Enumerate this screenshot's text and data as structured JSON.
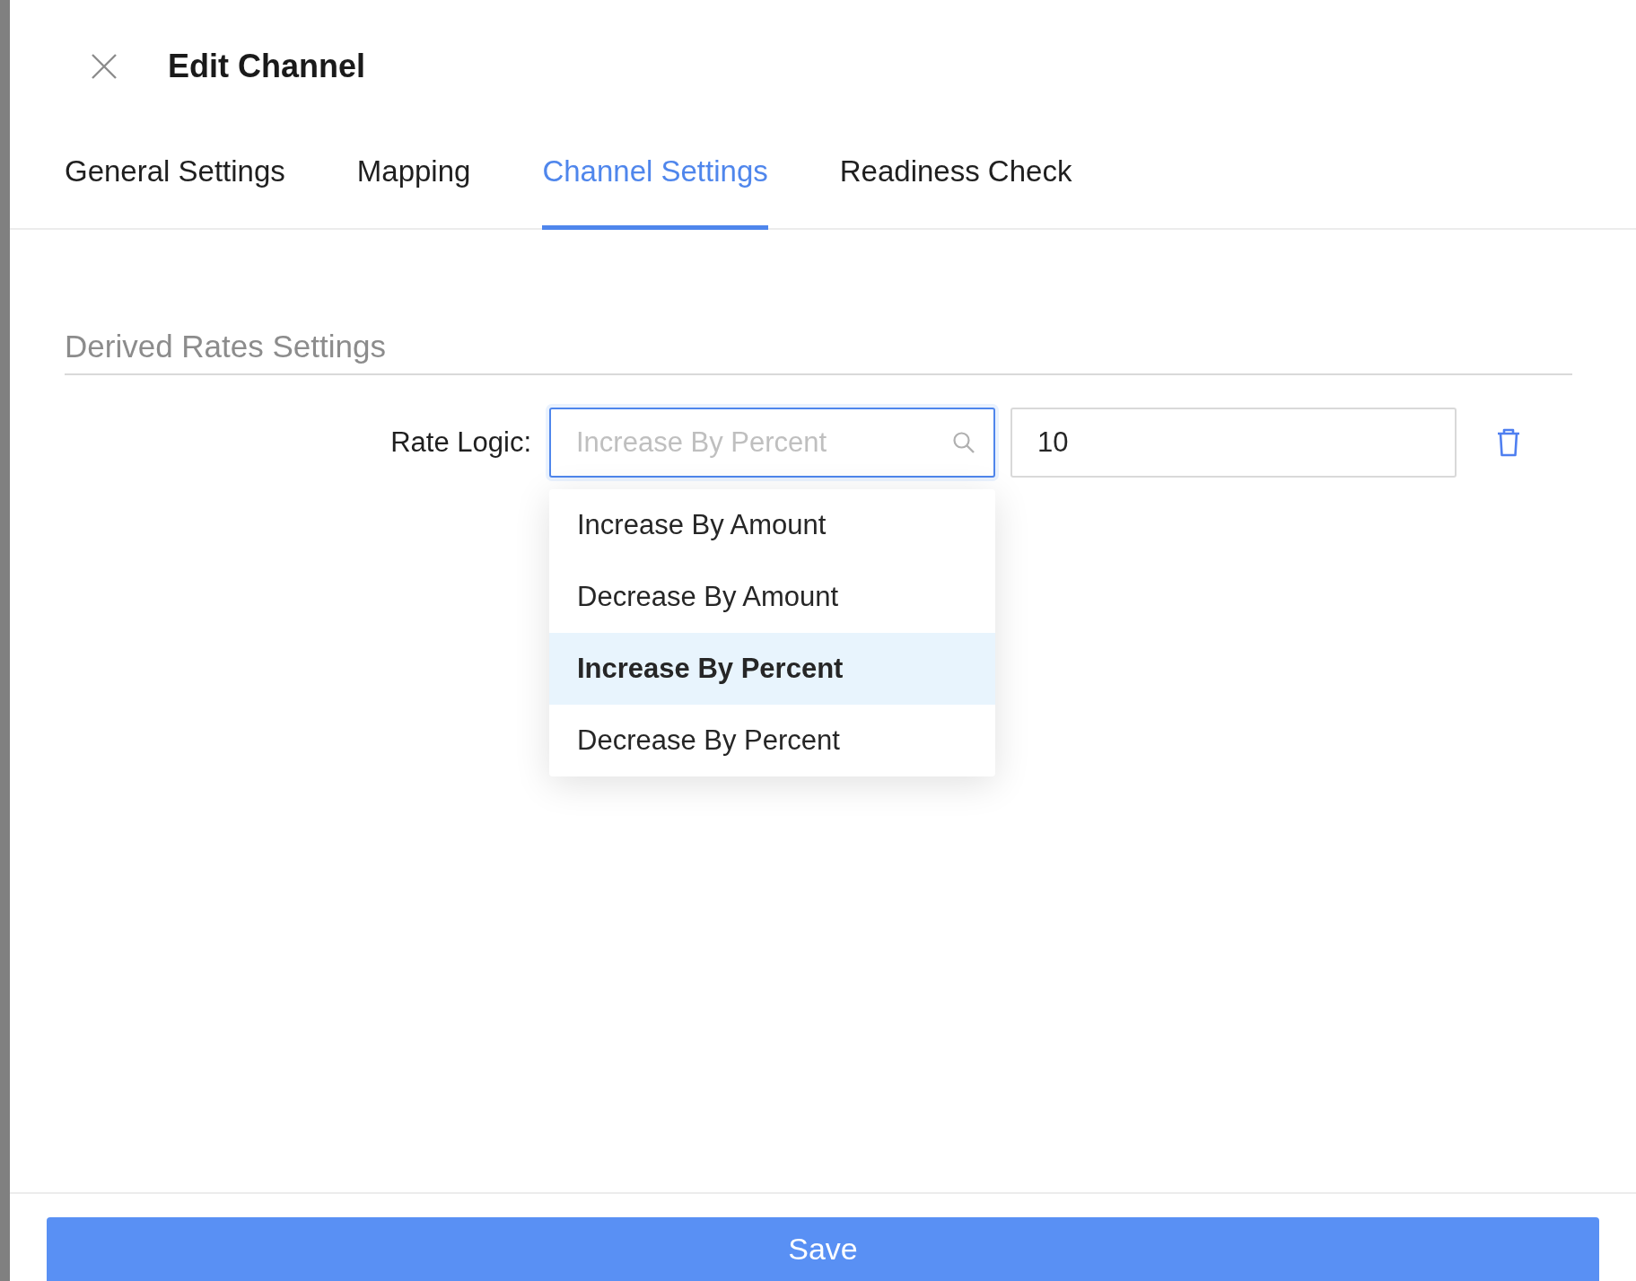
{
  "drawer": {
    "title": "Edit Channel"
  },
  "tabs": [
    {
      "label": "General Settings",
      "selected": false
    },
    {
      "label": "Mapping",
      "selected": false
    },
    {
      "label": "Channel Settings",
      "selected": true
    },
    {
      "label": "Readiness Check",
      "selected": false
    }
  ],
  "section": {
    "title": "Derived Rates Settings"
  },
  "rate_logic": {
    "label": "Rate Logic:",
    "placeholder": "Increase By Percent",
    "value": "10",
    "options": [
      {
        "label": "Increase By Amount",
        "selected": false
      },
      {
        "label": "Decrease By Amount",
        "selected": false
      },
      {
        "label": "Increase By Percent",
        "selected": true
      },
      {
        "label": "Decrease By Percent",
        "selected": false
      }
    ]
  },
  "footer": {
    "button": "Save"
  }
}
